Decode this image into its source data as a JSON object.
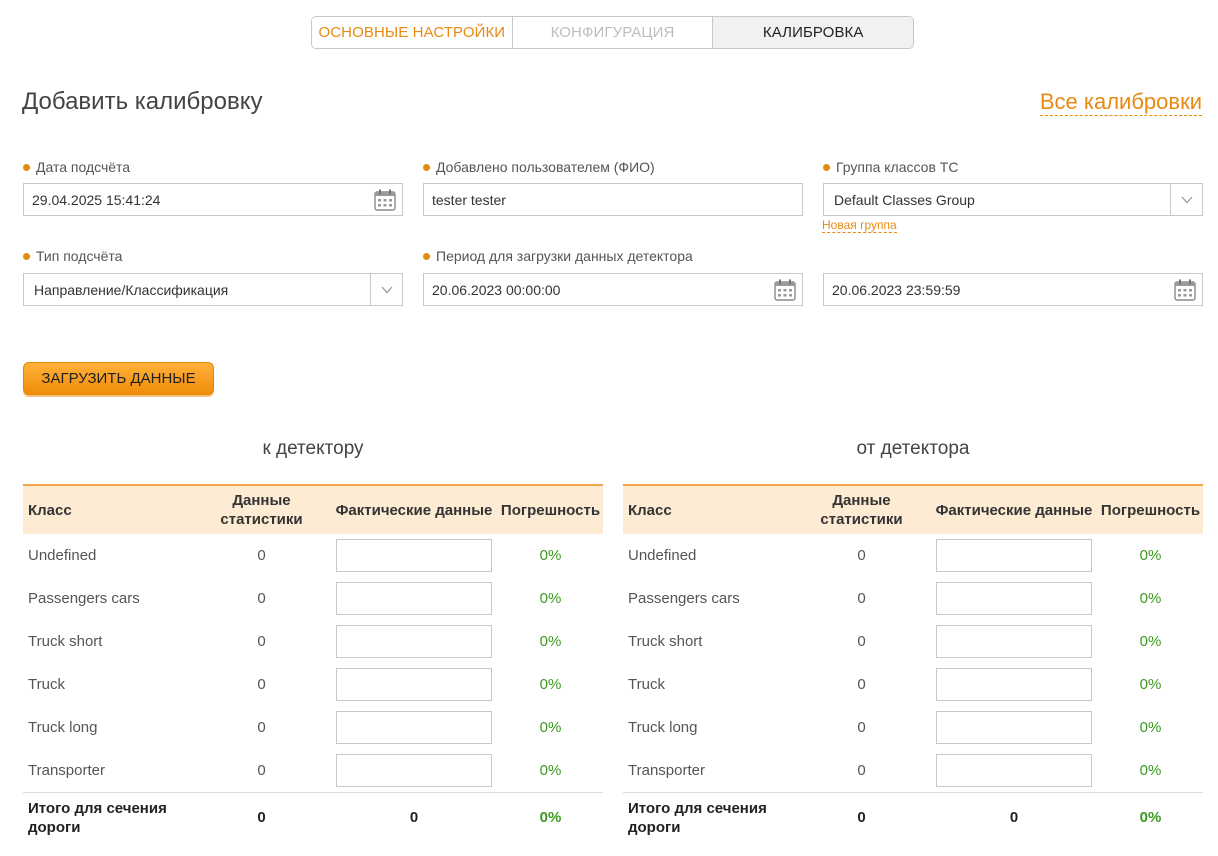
{
  "tabs": [
    {
      "label": "Основные настройки"
    },
    {
      "label": "Конфигурация"
    },
    {
      "label": "Калибровка"
    }
  ],
  "page": {
    "title": "Добавить калибровку",
    "all_calibrations_link": "Все калибровки"
  },
  "form": {
    "count_date": {
      "label": "Дата подсчёта",
      "value": "29.04.2025 15:41:24",
      "icon": "calendar-icon"
    },
    "added_by": {
      "label": "Добавлено пользователем (ФИО)",
      "value": "tester tester"
    },
    "class_group": {
      "label": "Группа классов ТС",
      "value": "Default Classes Group",
      "new_group_link": "Новая группа"
    },
    "count_type": {
      "label": "Тип подсчёта",
      "value": "Направление/Классификация"
    },
    "period": {
      "label": "Период для загрузки данных детектора",
      "from": "20.06.2023 00:00:00",
      "to": "20.06.2023 23:59:59"
    }
  },
  "load_button": "Загрузить данные",
  "columns": {
    "class": "Класс",
    "stats": "Данные статистики",
    "actual": "Фактические данные",
    "error": "Погрешность"
  },
  "sections": [
    {
      "title": "к детектору",
      "rows": [
        {
          "class": "Undefined",
          "stats": "0",
          "error": "0%"
        },
        {
          "class": "Passengers cars",
          "stats": "0",
          "error": "0%"
        },
        {
          "class": "Truck short",
          "stats": "0",
          "error": "0%"
        },
        {
          "class": "Truck",
          "stats": "0",
          "error": "0%"
        },
        {
          "class": "Truck long",
          "stats": "0",
          "error": "0%"
        },
        {
          "class": "Transporter",
          "stats": "0",
          "error": "0%"
        }
      ],
      "total": {
        "label": "Итого для сечения дороги",
        "stats": "0",
        "actual": "0",
        "error": "0%"
      }
    },
    {
      "title": "от детектора",
      "rows": [
        {
          "class": "Undefined",
          "stats": "0",
          "error": "0%"
        },
        {
          "class": "Passengers cars",
          "stats": "0",
          "error": "0%"
        },
        {
          "class": "Truck short",
          "stats": "0",
          "error": "0%"
        },
        {
          "class": "Truck",
          "stats": "0",
          "error": "0%"
        },
        {
          "class": "Truck long",
          "stats": "0",
          "error": "0%"
        },
        {
          "class": "Transporter",
          "stats": "0",
          "error": "0%"
        }
      ],
      "total": {
        "label": "Итого для сечения дороги",
        "stats": "0",
        "actual": "0",
        "error": "0%"
      }
    }
  ],
  "colors": {
    "accent": "#e88a12",
    "error_ok": "#3a9a1e",
    "header_bg": "#fdebd3"
  }
}
